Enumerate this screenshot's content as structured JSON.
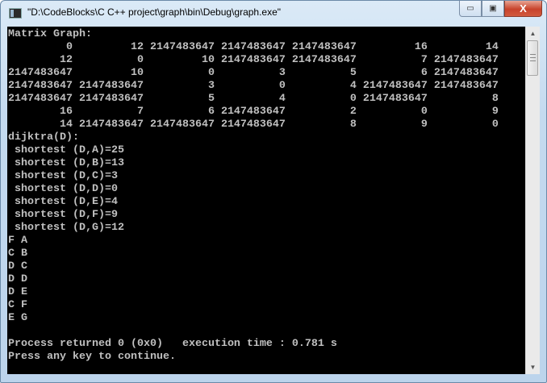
{
  "window": {
    "title": "\"D:\\CodeBlocks\\C C++ project\\graph\\bin\\Debug\\graph.exe\"",
    "minimize_label": "▭",
    "maximize_label": "▣",
    "close_label": "X"
  },
  "console": {
    "matrix_header": "Matrix Graph:",
    "matrix": [
      [
        0,
        12,
        2147483647,
        2147483647,
        2147483647,
        16,
        14
      ],
      [
        12,
        0,
        10,
        2147483647,
        2147483647,
        7,
        2147483647
      ],
      [
        2147483647,
        10,
        0,
        3,
        5,
        6,
        2147483647
      ],
      [
        2147483647,
        2147483647,
        3,
        0,
        4,
        2147483647,
        2147483647
      ],
      [
        2147483647,
        2147483647,
        5,
        4,
        0,
        2147483647,
        8
      ],
      [
        16,
        7,
        6,
        2147483647,
        2,
        0,
        9
      ],
      [
        14,
        2147483647,
        2147483647,
        2147483647,
        8,
        9,
        0
      ]
    ],
    "dijkstra_header": "dijktra(D):",
    "shortest": [
      " shortest (D,A)=25",
      " shortest (D,B)=13",
      " shortest (D,C)=3",
      " shortest (D,D)=0",
      " shortest (D,E)=4",
      " shortest (D,F)=9",
      " shortest (D,G)=12"
    ],
    "paths": [
      "F A",
      "C B",
      "D C",
      "D D",
      "D E",
      "C F",
      "E G"
    ],
    "process_line": "Process returned 0 (0x0)   execution time : 0.781 s",
    "continue_line": "Press any key to continue."
  },
  "scrollbar": {
    "up": "▲",
    "down": "▼"
  }
}
